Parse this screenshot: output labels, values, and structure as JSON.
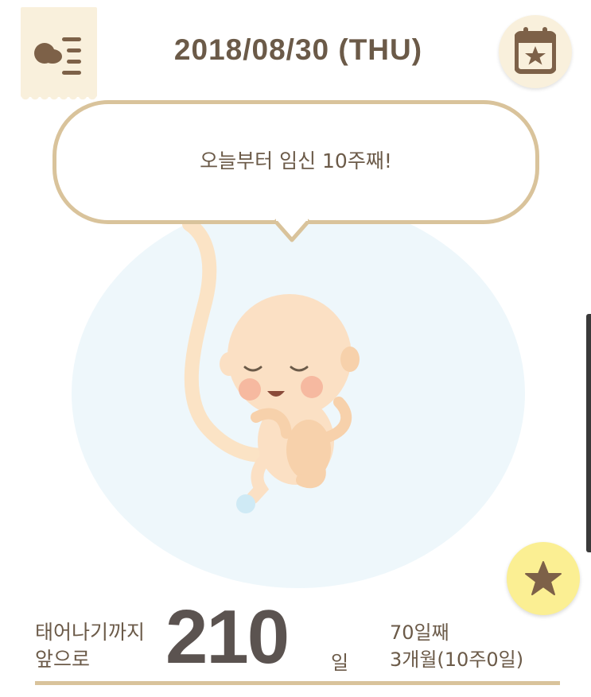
{
  "header": {
    "date": "2018/08/30 (THU)",
    "menu_icon": "baby-menu-icon",
    "calendar_icon": "calendar-star-icon"
  },
  "bubble": {
    "message": "오늘부터 임신 10주째!"
  },
  "illustration": {
    "icon": "fetus-illustration"
  },
  "favorite": {
    "icon": "star-icon"
  },
  "countdown": {
    "label_line1": "태어나기까지",
    "label_line2": "앞으로",
    "days": "210",
    "unit": "일",
    "info_line1": "70일째",
    "info_line2": "3개월(10주0일)"
  },
  "colors": {
    "accent": "#d9c39b",
    "tab_background": "#f9f0dc",
    "star_button": "#fbef93",
    "text": "#6b5a48",
    "number": "#5b5350",
    "womb": "#eef7fb"
  }
}
